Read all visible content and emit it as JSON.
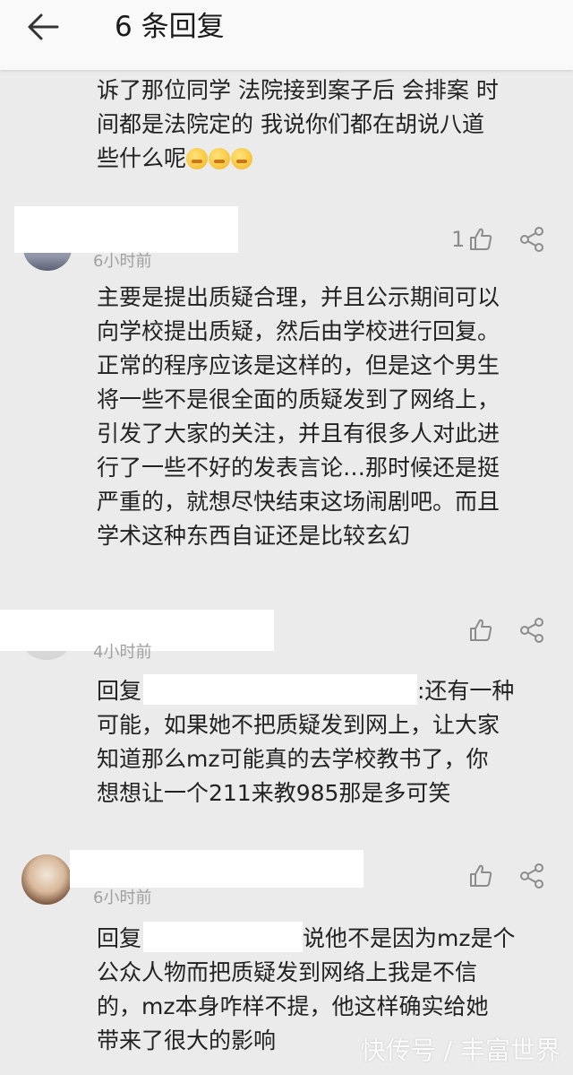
{
  "header": {
    "title": "6 条回复"
  },
  "comments": [
    {
      "lines": [
        "诉了那位同学 法院接到案子后 会排案 时",
        "间都是法院定的 我说你们都在胡说八道",
        "些什么呢"
      ],
      "emoji_count": 3
    },
    {
      "time": "6小时前",
      "like_count": "1",
      "lines": [
        "主要是提出质疑合理，并且公示期间可以",
        "向学校提出质疑，然后由学校进行回复。",
        "正常的程序应该是这样的，但是这个男生",
        "将一些不是很全面的质疑发到了网络上，",
        "引发了大家的关注，并且有很多人对此进",
        "行了一些不好的发表言论…那时候还是挺",
        "严重的，就想尽快结束这场闹剧吧。而且",
        "学术这种东西自证还是比较玄幻"
      ]
    },
    {
      "time": "4小时前",
      "reply_prefix": "回复",
      "first_line_tail": ":还有一种",
      "lines": [
        "可能，如果她不把质疑发到网上，让大家",
        "知道那么mz可能真的去学校教书了，你",
        "想想让一个211来教985那是多可笑"
      ]
    },
    {
      "time": "6小时前",
      "reply_prefix": "回复",
      "first_line_tail": "说他不是因为mz是个",
      "lines": [
        "公众人物而把质疑发到网络上我是不信",
        "的，mz本身咋样不提，他这样确实给她",
        "带来了很大的影响"
      ]
    }
  ],
  "watermark": "快传号 / 丰富世界",
  "icons": {
    "back": "back-arrow-icon",
    "like": "thumbs-up-icon",
    "share": "share-icon",
    "emoji": "emoji-icon"
  },
  "colors": {
    "background": "#ebebeb",
    "header": "#f9f9f9",
    "text": "#222222",
    "meta": "#a0a0a0",
    "icon": "#8c8c8c"
  }
}
